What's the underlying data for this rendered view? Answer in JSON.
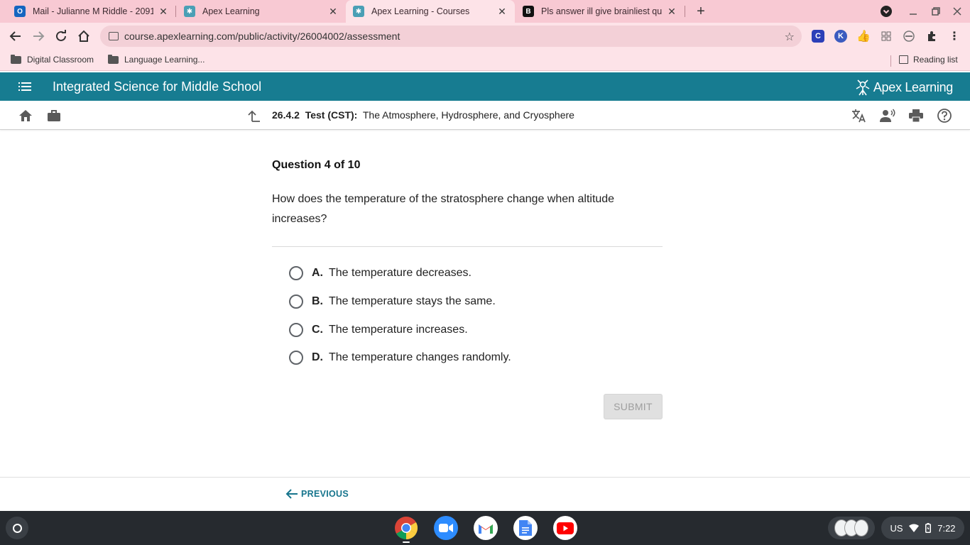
{
  "browser": {
    "tabs": [
      {
        "title": "Mail - Julianne M Riddle - 20914",
        "icon": "outlook-icon",
        "active": false
      },
      {
        "title": "Apex Learning",
        "icon": "apex-icon",
        "active": false
      },
      {
        "title": "Apex Learning - Courses",
        "icon": "apex-icon",
        "active": true
      },
      {
        "title": "Pls answer ill give brainliest que",
        "icon": "brainly-icon",
        "active": false
      }
    ],
    "url": "course.apexlearning.com/public/activity/26004002/assessment",
    "bookmarks": [
      "Digital Classroom",
      "Language Learning..."
    ],
    "reading_list": "Reading list",
    "extension_labels": {
      "c": "C",
      "k": "K"
    }
  },
  "app": {
    "course_title": "Integrated Science for Middle School",
    "brand": "Apex Learning",
    "activity_id": "26.4.2",
    "activity_type": "Test (CST):",
    "activity_name": "The Atmosphere, Hydrosphere, and Cryosphere"
  },
  "question": {
    "number": "Question 4 of 10",
    "text": "How does the temperature of the stratosphere change when altitude increases?",
    "options": [
      {
        "letter": "A.",
        "text": "The temperature decreases."
      },
      {
        "letter": "B.",
        "text": "The temperature stays the same."
      },
      {
        "letter": "C.",
        "text": "The temperature increases."
      },
      {
        "letter": "D.",
        "text": "The temperature changes randomly."
      }
    ],
    "submit_label": "SUBMIT"
  },
  "footer": {
    "previous_label": "PREVIOUS"
  },
  "shelf": {
    "apps": [
      "chrome-icon",
      "zoom-icon",
      "gmail-icon",
      "docs-icon",
      "youtube-icon"
    ],
    "locale": "US",
    "time": "7:22"
  },
  "colors": {
    "tab_strip": "#f8c9d3",
    "toolbar": "#fde3e8",
    "app_header": "#177c91",
    "link": "#17758d"
  }
}
